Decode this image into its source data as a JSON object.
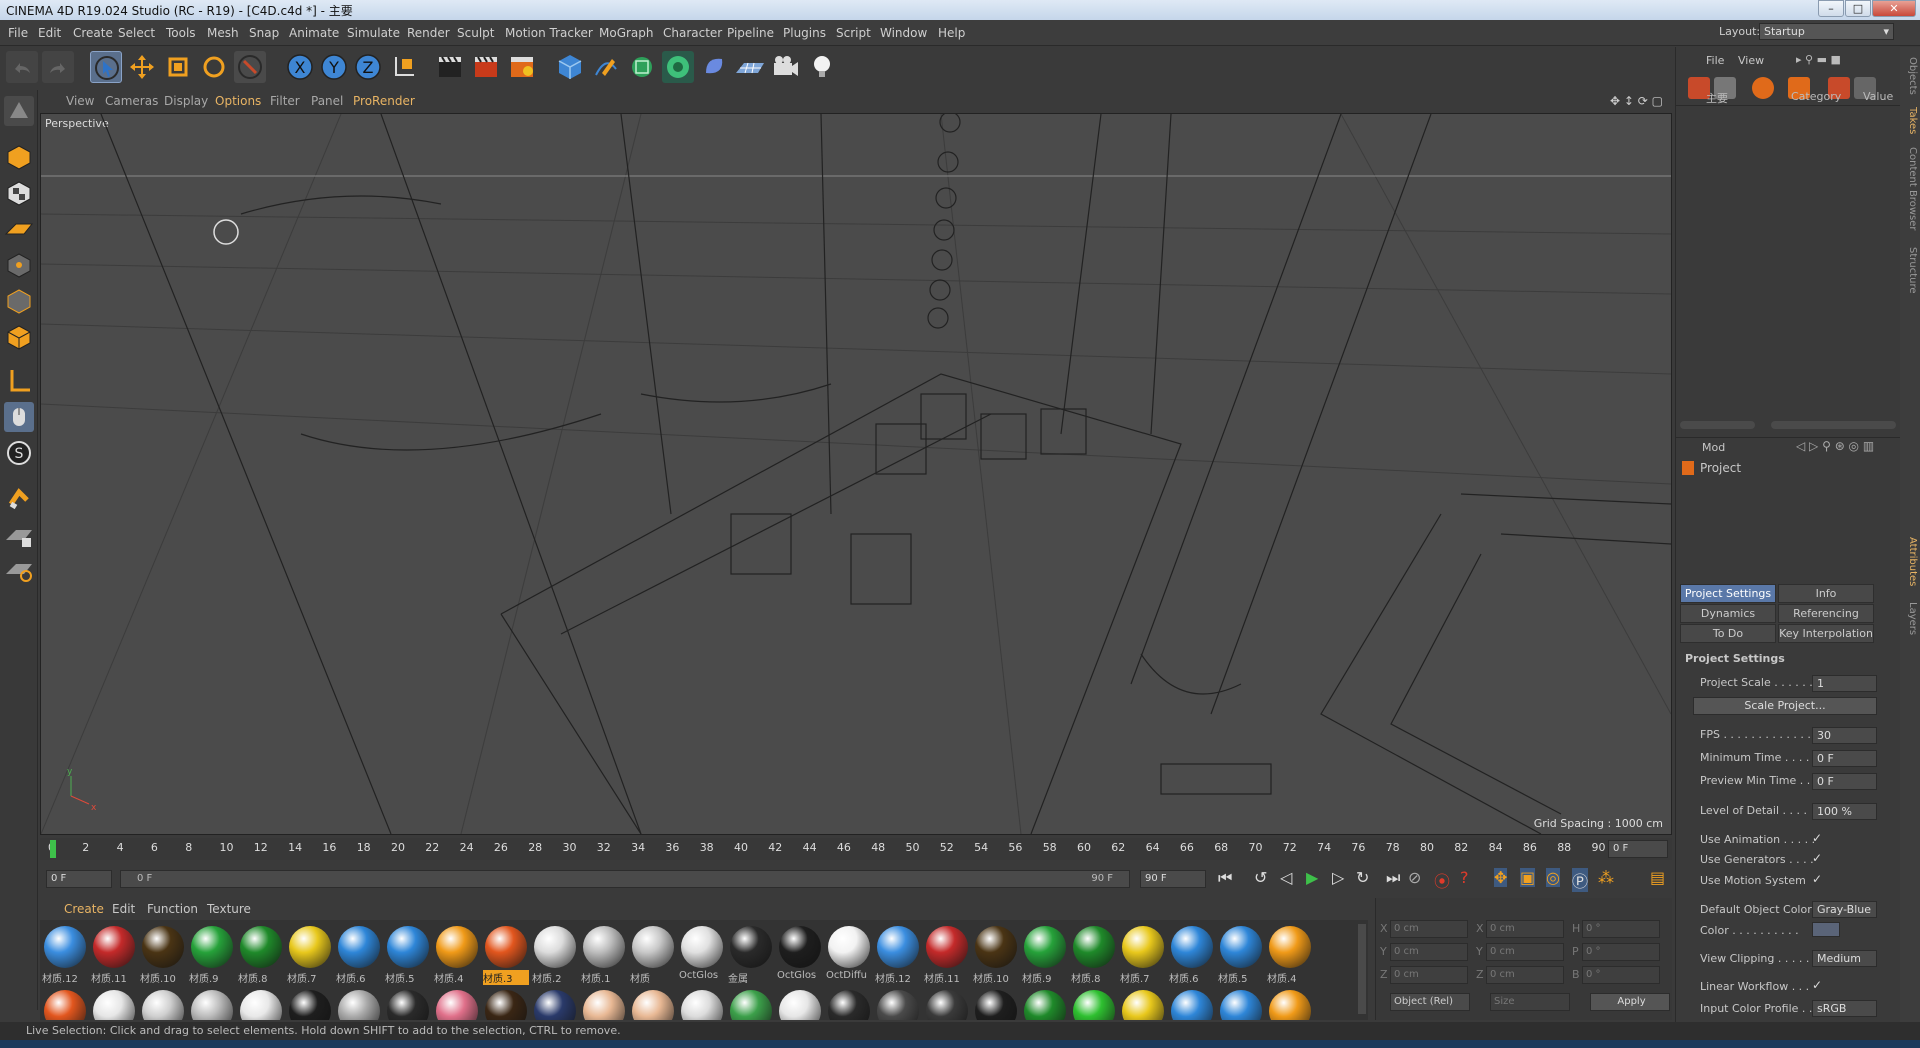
{
  "window": {
    "title": "CINEMA 4D R19.024 Studio (RC - R19) - [C4D.c4d *] - 主要"
  },
  "menu": [
    "File",
    "Edit",
    "Create",
    "Select",
    "Tools",
    "Mesh",
    "Snap",
    "Animate",
    "Simulate",
    "Render",
    "Sculpt",
    "Motion Tracker",
    "MoGraph",
    "Character",
    "Pipeline",
    "Plugins",
    "Script",
    "Window",
    "Help"
  ],
  "layout": {
    "label": "Layout:",
    "value": "Startup"
  },
  "viewport": {
    "menu": [
      "View",
      "Cameras",
      "Display",
      "Options",
      "Filter",
      "Panel",
      "ProRender"
    ],
    "camera": "Perspective",
    "grid_spacing": "Grid Spacing : 1000 cm"
  },
  "timeline": {
    "ticks": [
      "0",
      "2",
      "4",
      "6",
      "8",
      "10",
      "12",
      "14",
      "16",
      "18",
      "20",
      "22",
      "24",
      "26",
      "28",
      "30",
      "32",
      "34",
      "36",
      "38",
      "40",
      "42",
      "44",
      "46",
      "48",
      "50",
      "52",
      "54",
      "56",
      "58",
      "60",
      "62",
      "64",
      "66",
      "68",
      "70",
      "72",
      "74",
      "76",
      "78",
      "80",
      "82",
      "84",
      "86",
      "88",
      "90"
    ],
    "current": "0 F"
  },
  "transport": {
    "start": "0 F",
    "slider_start": "0 F",
    "slider_end": "90 F",
    "end": "90 F"
  },
  "material_menu": [
    "Create",
    "Edit",
    "Function",
    "Texture"
  ],
  "materials_row1": [
    {
      "label": "材质.12",
      "color": "#3b8ee0"
    },
    {
      "label": "材质.11",
      "color": "#c42a2a"
    },
    {
      "label": "材质.10",
      "color": "#4a3414"
    },
    {
      "label": "材质.9",
      "color": "#26a23a"
    },
    {
      "label": "材质.8",
      "color": "#1f8a2a"
    },
    {
      "label": "材质.7",
      "color": "#e8c81c"
    },
    {
      "label": "材质.6",
      "color": "#2e86d8"
    },
    {
      "label": "材质.5",
      "color": "#2e86d8"
    },
    {
      "label": "材质.4",
      "color": "#f09a18"
    },
    {
      "label": "材质.3",
      "color": "#e2561e"
    },
    {
      "label": "材质.2",
      "color": "#dcdcdc"
    },
    {
      "label": "材质.1",
      "color": "#bdbdbd"
    },
    {
      "label": "材质",
      "color": "#c8c8c8"
    },
    {
      "label": "OctGlos",
      "color": "#e0e0e0"
    },
    {
      "label": "金属",
      "color": "#2a2a2a"
    },
    {
      "label": "OctGlos",
      "color": "#1e1e1e"
    },
    {
      "label": "OctDiffu",
      "color": "#f2f2f2"
    },
    {
      "label": "材质.12",
      "color": "#3b8ee0"
    },
    {
      "label": "材质.11",
      "color": "#c42a2a"
    },
    {
      "label": "材质.10",
      "color": "#4a3414"
    },
    {
      "label": "材质.9",
      "color": "#26a23a"
    },
    {
      "label": "材质.8",
      "color": "#1f8a2a"
    },
    {
      "label": "材质.7",
      "color": "#e8c81c"
    },
    {
      "label": "材质.6",
      "color": "#2e86d8"
    },
    {
      "label": "材质.5",
      "color": "#2e86d8"
    },
    {
      "label": "材质.4",
      "color": "#f09a18"
    }
  ],
  "materials_row2": [
    "#e2561e",
    "#e6e6e6",
    "#cfcfcf",
    "#bcbcbc",
    "#e8e8e8",
    "#1e1e1e",
    "#aaaaaa",
    "#2a2a2a",
    "#e0708a",
    "#3a2614",
    "#2a3a6a",
    "#e8b894",
    "#e8b894",
    "#dcdcdc",
    "#3ca04a",
    "#e6e6e6",
    "#2a2a2a",
    "#4a4a4a",
    "#3a3a3a",
    "#1e1e1e",
    "#1f8a2a",
    "#2ec030",
    "#e8c81c",
    "#2e86d8",
    "#2e86d8",
    "#f09a18"
  ],
  "coords": {
    "x1": "0 cm",
    "y1": "0 cm",
    "z1": "0 cm",
    "x2": "0 cm",
    "y2": "0 cm",
    "z2": "0 cm",
    "h": "0 °",
    "p": "0 °",
    "b": "0 °",
    "mode": "Object (Rel)",
    "size": "Size",
    "apply": "Apply"
  },
  "objects": {
    "menu": [
      "File",
      "View"
    ],
    "col_name": "主要",
    "col_category": "Category",
    "col_value": "Value"
  },
  "attributes": {
    "mode": "Mod",
    "project": "Project",
    "tabs": [
      "Project Settings",
      "Info",
      "Dynamics",
      "Referencing",
      "To Do",
      "Key Interpolation"
    ],
    "section": "Project Settings",
    "rows": [
      {
        "label": "Project Scale . . . . . .",
        "value": "1"
      },
      {
        "label": "FPS . . . . . . . . . . . . . . .",
        "value": "30"
      },
      {
        "label": "Minimum Time . . . .",
        "value": "0 F"
      },
      {
        "label": "Preview Min Time . .",
        "value": "0 F"
      },
      {
        "label": "Level of Detail . . . .",
        "value": "100 %"
      }
    ],
    "scale_button": "Scale Project...",
    "checks": [
      "Use Animation . . . . .",
      "Use Generators . . . .",
      "Use Motion System"
    ],
    "default_color_label": "Default Object Color",
    "default_color_value": "Gray-Blue",
    "color_label": "Color . . . . . . . . . .",
    "view_clipping_label": "View Clipping . . . . .",
    "view_clipping_value": "Medium",
    "linear_workflow": "Linear Workflow . . .",
    "input_profile_label": "Input Color Profile . .",
    "input_profile_value": "sRGB"
  },
  "side_tabs": [
    "Objects",
    "Takes",
    "Content Browser",
    "Structure",
    "Attributes",
    "Layers"
  ],
  "status": "Live Selection: Click and drag to select elements. Hold down SHIFT to add to the selection, CTRL to remove.",
  "colors": {
    "accent": "#5a78a8",
    "viewport_bg": "#4b4b4b"
  }
}
